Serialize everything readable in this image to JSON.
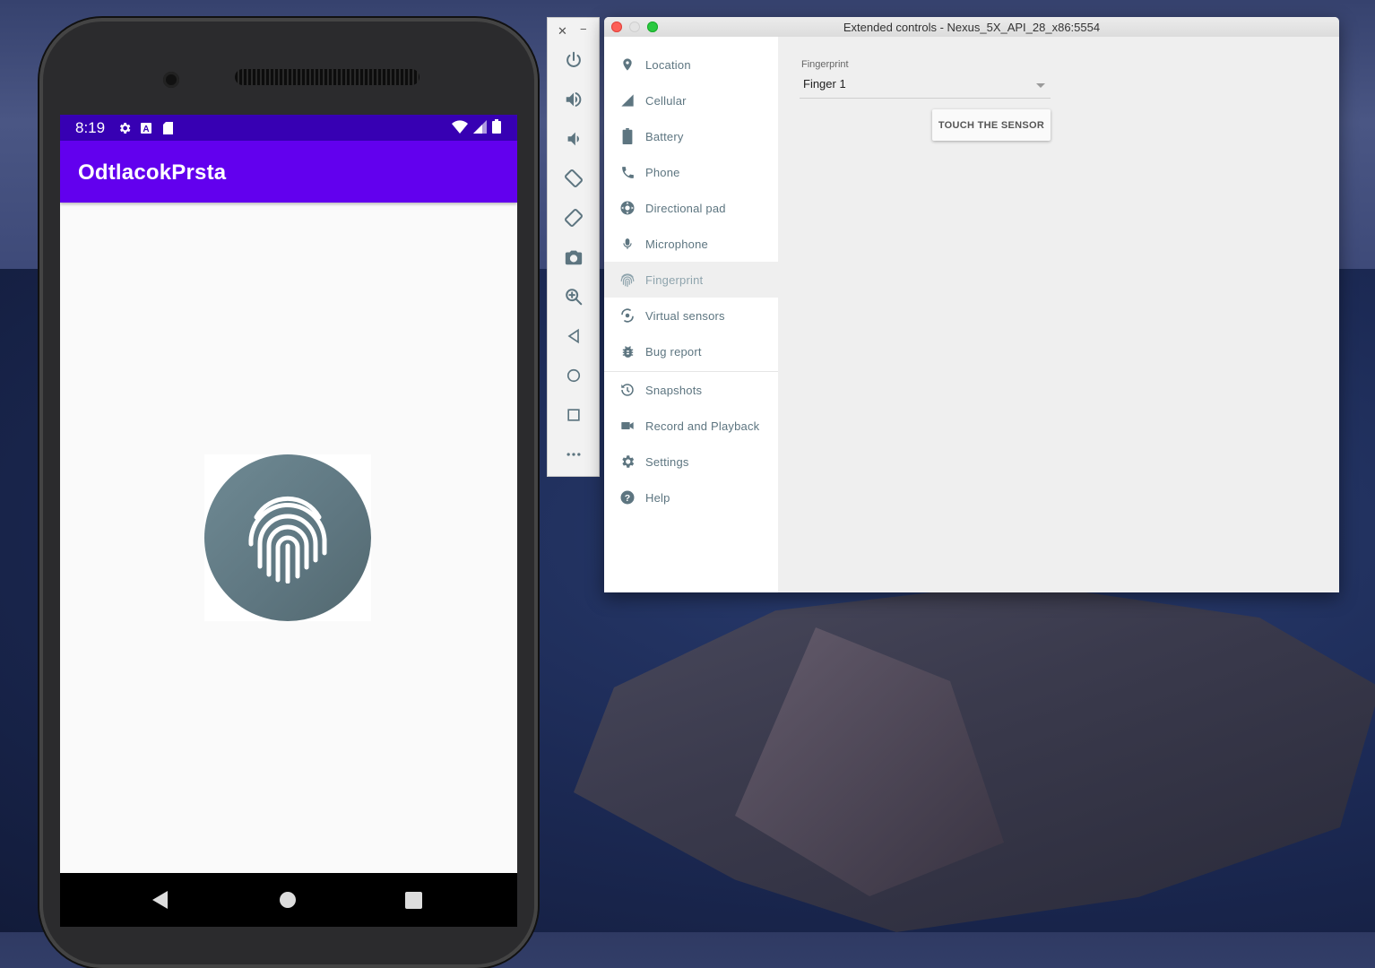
{
  "phone": {
    "status_time": "8:19",
    "app_title": "OdtlacokPrsta",
    "icons": {
      "status": [
        "settings-icon",
        "a-icon",
        "sd-card-icon",
        "wifi-icon",
        "signal-icon",
        "battery-icon"
      ],
      "nav": [
        "back-icon",
        "home-icon",
        "recents-icon"
      ],
      "center": "fingerprint-icon"
    },
    "colors": {
      "status_bar": "#3700b3",
      "app_bar": "#6200ee",
      "fingerprint_circle": "#607d8b"
    }
  },
  "toolbar": {
    "icons": [
      "close-icon",
      "minimize-icon",
      "power-icon",
      "volume-up-icon",
      "volume-down-icon",
      "rotate-left-icon",
      "rotate-right-icon",
      "camera-icon",
      "zoom-icon",
      "back-icon",
      "home-icon",
      "overview-icon",
      "more-icon"
    ]
  },
  "window": {
    "title": "Extended controls - Nexus_5X_API_28_x86:5554",
    "sidebar": {
      "items": [
        {
          "label": "Location",
          "icon": "location-pin-icon"
        },
        {
          "label": "Cellular",
          "icon": "cellular-signal-icon"
        },
        {
          "label": "Battery",
          "icon": "battery-icon"
        },
        {
          "label": "Phone",
          "icon": "phone-icon"
        },
        {
          "label": "Directional pad",
          "icon": "dpad-icon"
        },
        {
          "label": "Microphone",
          "icon": "microphone-icon"
        },
        {
          "label": "Fingerprint",
          "icon": "fingerprint-icon"
        },
        {
          "label": "Virtual sensors",
          "icon": "virtual-sensors-icon"
        },
        {
          "label": "Bug report",
          "icon": "bug-icon"
        },
        {
          "label": "Snapshots",
          "icon": "history-icon"
        },
        {
          "label": "Record and Playback",
          "icon": "video-camera-icon"
        },
        {
          "label": "Settings",
          "icon": "gear-icon"
        },
        {
          "label": "Help",
          "icon": "help-icon"
        }
      ],
      "active": "Fingerprint"
    },
    "fingerprint": {
      "label": "Fingerprint",
      "selected": "Finger 1",
      "button": "TOUCH THE SENSOR"
    }
  }
}
